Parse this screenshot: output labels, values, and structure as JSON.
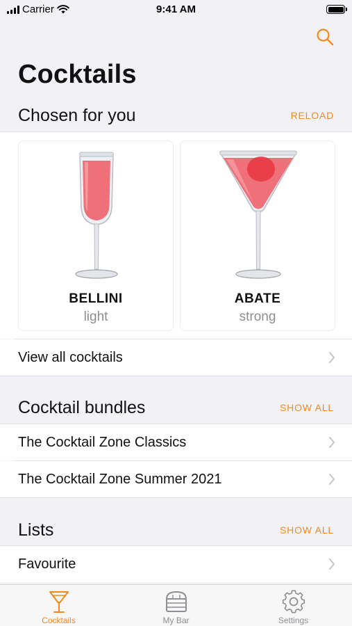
{
  "status_bar": {
    "carrier": "Carrier",
    "time": "9:41 AM"
  },
  "header": {
    "title": "Cocktails",
    "search_icon": "search-icon"
  },
  "chosen": {
    "title": "Chosen for you",
    "action": "RELOAD",
    "cards": [
      {
        "name": "BELLINI",
        "strength": "light",
        "glass": "flute-glass-icon"
      },
      {
        "name": "ABATE",
        "strength": "strong",
        "glass": "martini-glass-icon"
      }
    ],
    "view_all": "View all cocktails"
  },
  "bundles": {
    "title": "Cocktail bundles",
    "action": "SHOW ALL",
    "items": [
      "The Cocktail Zone Classics",
      "The Cocktail Zone Summer 2021"
    ]
  },
  "lists": {
    "title": "Lists",
    "action": "SHOW ALL",
    "items": [
      "Favourite"
    ]
  },
  "tabbar": {
    "tabs": [
      {
        "label": "Cocktails",
        "icon": "cocktail-icon",
        "active": true
      },
      {
        "label": "My Bar",
        "icon": "bar-icon",
        "active": false
      },
      {
        "label": "Settings",
        "icon": "gear-icon",
        "active": false
      }
    ]
  },
  "colors": {
    "accent": "#f3891a",
    "background": "#f2f2f6",
    "drink": "#f0707a"
  }
}
